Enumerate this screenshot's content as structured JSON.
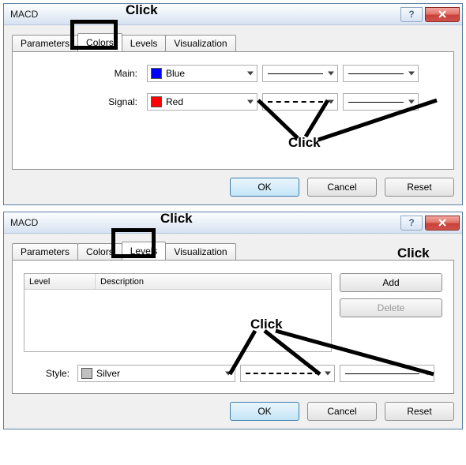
{
  "annotations": {
    "click": "Click"
  },
  "dialog1": {
    "title": "MACD",
    "tabs": [
      "Parameters",
      "Colors",
      "Levels",
      "Visualization"
    ],
    "active_tab": "Colors",
    "rows": {
      "main": {
        "label": "Main:",
        "color_name": "Blue",
        "swatch": "#0000ff"
      },
      "signal": {
        "label": "Signal:",
        "color_name": "Red",
        "swatch": "#ff0000"
      }
    },
    "buttons": {
      "ok": "OK",
      "cancel": "Cancel",
      "reset": "Reset"
    }
  },
  "dialog2": {
    "title": "MACD",
    "tabs": [
      "Parameters",
      "Colors",
      "Levels",
      "Visualization"
    ],
    "active_tab": "Levels",
    "list_headers": {
      "level": "Level",
      "description": "Description"
    },
    "side_buttons": {
      "add": "Add",
      "delete": "Delete"
    },
    "style": {
      "label": "Style:",
      "color_name": "Silver",
      "swatch": "#c0c0c0"
    },
    "buttons": {
      "ok": "OK",
      "cancel": "Cancel",
      "reset": "Reset"
    }
  }
}
